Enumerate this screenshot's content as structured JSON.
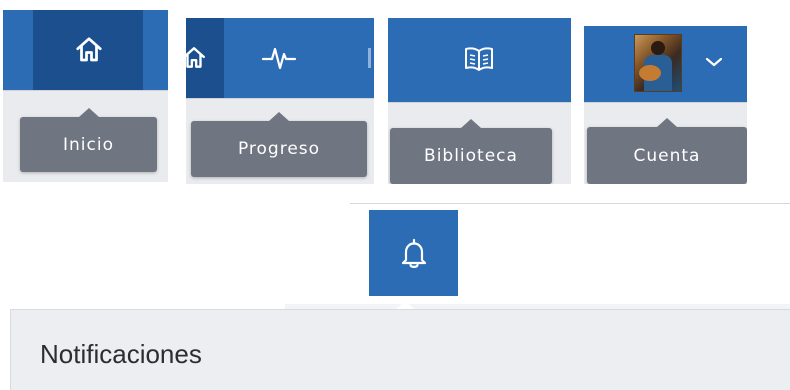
{
  "colors": {
    "nav_bar": "#2b6cb5",
    "nav_active": "#1b4f8e",
    "tooltip_bg": "#6f7581",
    "tooltip_text": "#ffffff",
    "notification_panel": "#eceef1"
  },
  "tooltips": {
    "home": "Inicio",
    "progress": "Progreso",
    "library": "Biblioteca",
    "account": "Cuenta"
  },
  "icons": {
    "home": "home-icon",
    "progress": "pulse-icon",
    "library": "book-icon",
    "account_avatar": "avatar",
    "account_menu": "chevron-down-icon",
    "notifications": "bell-icon"
  },
  "notifications": {
    "title": "Notificaciones"
  }
}
